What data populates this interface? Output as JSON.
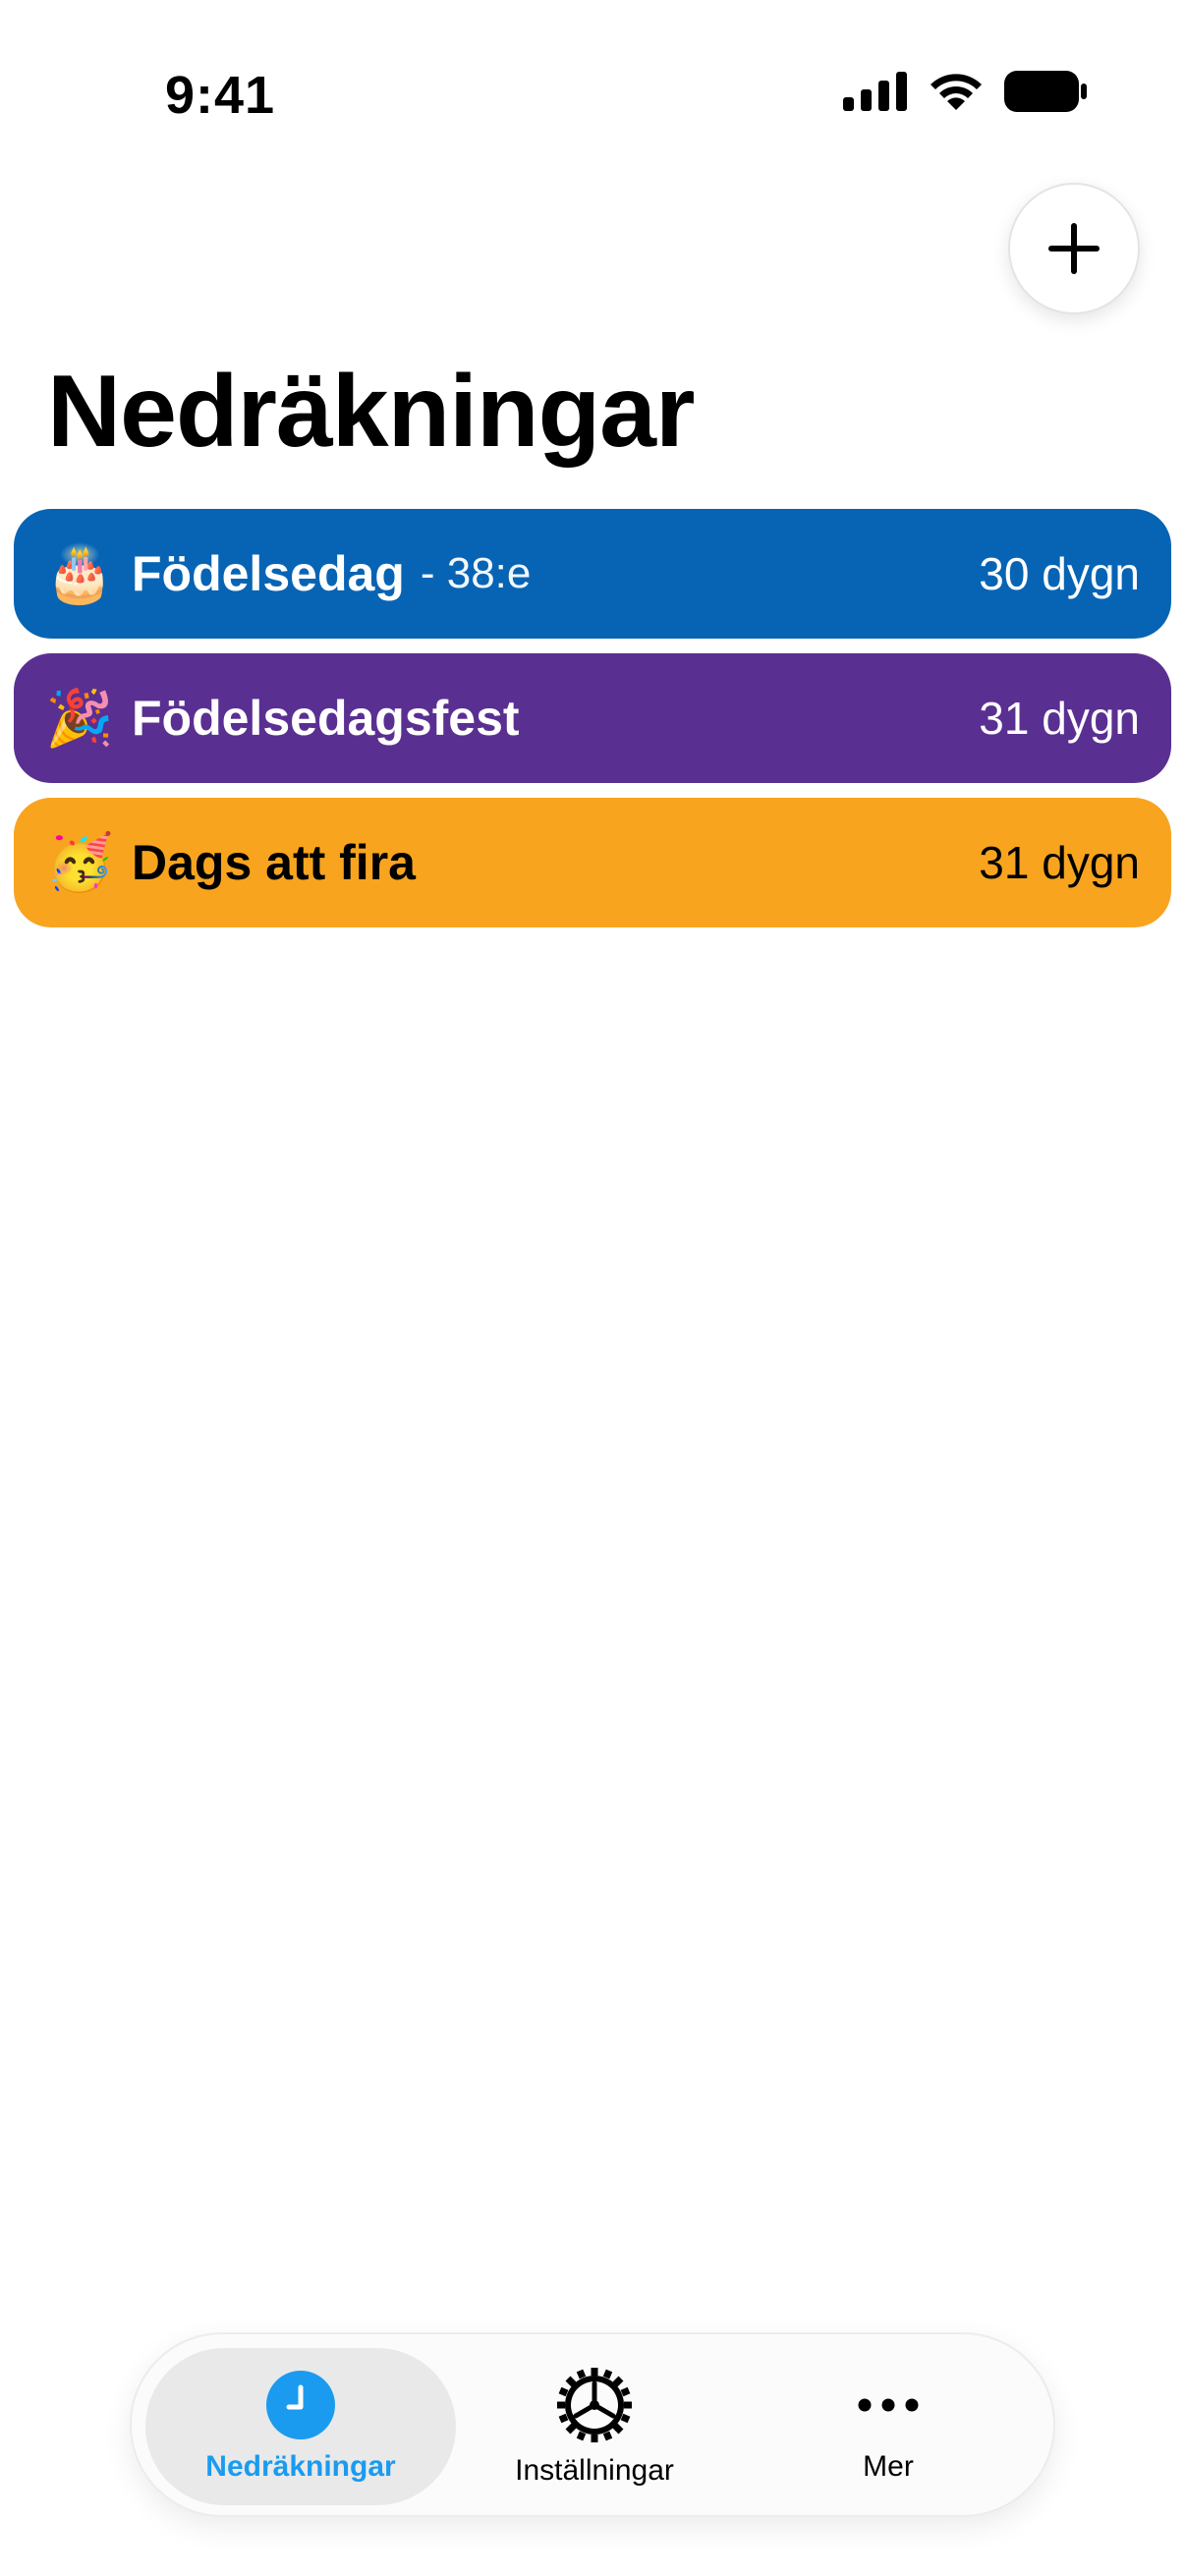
{
  "status_bar": {
    "time": "9:41",
    "icons": [
      "signal-icon",
      "wifi-icon",
      "battery-icon"
    ]
  },
  "header": {
    "add_icon": "plus-icon",
    "title": "Nedräkningar"
  },
  "countdowns": [
    {
      "emoji": "🎂",
      "icon": "birthday-cake-icon",
      "title": "Födelsedag",
      "subtitle": "- 38:e",
      "days": "30 dygn",
      "color": "#0764b4",
      "text_color": "#ffffff"
    },
    {
      "emoji": "🎉",
      "icon": "party-popper-icon",
      "title": "Födelsedagsfest",
      "subtitle": "",
      "days": "31 dygn",
      "color": "#5a2f92",
      "text_color": "#ffffff"
    },
    {
      "emoji": "🥳",
      "icon": "partying-face-icon",
      "title": "Dags att fira",
      "subtitle": "",
      "days": "31 dygn",
      "color": "#f8a41f",
      "text_color": "#000000"
    }
  ],
  "tab_bar": {
    "tabs": [
      {
        "label": "Nedräkningar",
        "icon": "clock-icon",
        "active": true
      },
      {
        "label": "Inställningar",
        "icon": "gear-icon",
        "active": false
      },
      {
        "label": "Mer",
        "icon": "more-icon",
        "active": false
      }
    ],
    "accent_color": "#1a9bf0"
  }
}
